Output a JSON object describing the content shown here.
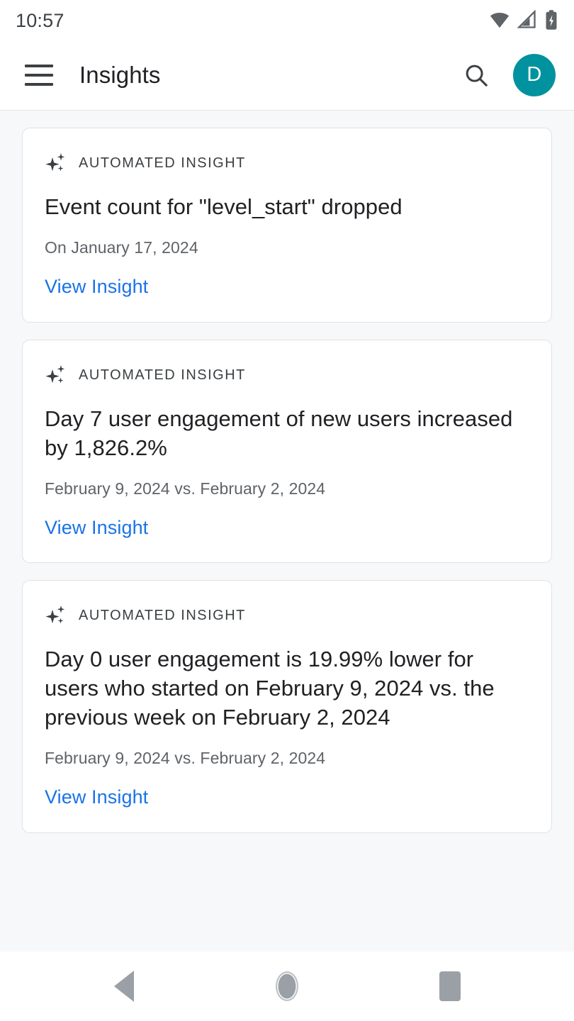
{
  "status_bar": {
    "time": "10:57",
    "icons": [
      "wifi-icon",
      "cellular-signal-icon",
      "battery-charging-icon"
    ]
  },
  "app_bar": {
    "menu_icon": "hamburger-menu-icon",
    "title": "Insights",
    "search_icon": "search-icon",
    "avatar_initial": "D",
    "avatar_color": "#00929E"
  },
  "theme": {
    "page_background": "#F6F8FA",
    "card_background": "#FFFFFF",
    "card_border": "#E0E2E5",
    "link_color": "#1A73E8",
    "primary_text": "#202124",
    "secondary_text": "#5F6368",
    "accent": "#00929E"
  },
  "cards": [
    {
      "kicker": "AUTOMATED INSIGHT",
      "icon": "sparkle-icon",
      "title": "Event count for \"level_start\" dropped",
      "subtitle": "On January 17, 2024",
      "action": "View Insight"
    },
    {
      "kicker": "AUTOMATED INSIGHT",
      "icon": "sparkle-icon",
      "title": "Day 7 user engagement of new users increased by 1,826.2%",
      "subtitle": "February 9, 2024 vs. February 2, 2024",
      "action": "View Insight"
    },
    {
      "kicker": "AUTOMATED INSIGHT",
      "icon": "sparkle-icon",
      "title": "Day 0 user engagement is 19.99% lower for users who started on February 9, 2024 vs. the previous week on February 2, 2024",
      "subtitle": "February 9, 2024 vs. February 2, 2024",
      "action": "View Insight"
    }
  ],
  "nav_bar": {
    "back_label": "Back",
    "home_label": "Home",
    "recents_label": "Recents"
  }
}
